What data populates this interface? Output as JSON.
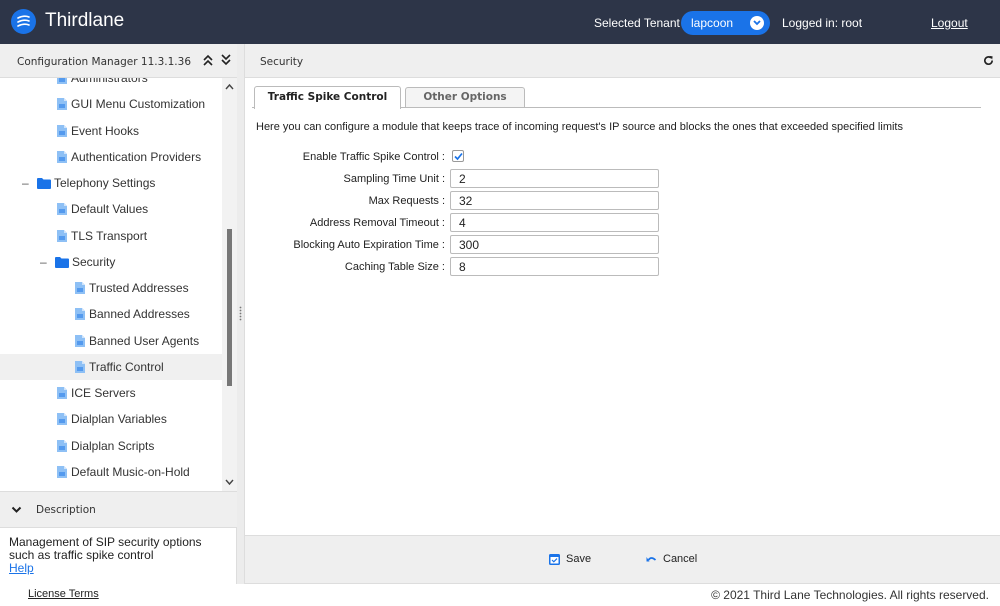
{
  "header": {
    "brand": "Thirdlane",
    "tenant_label": "Selected Tenant :",
    "tenant_value": "lapcoon",
    "logged_in": "Logged in: root",
    "logout": "Logout"
  },
  "left_panel": {
    "title": "Configuration Manager 11.3.1.36",
    "tree": [
      {
        "label": "Administrators",
        "type": "doc",
        "level": 2
      },
      {
        "label": "GUI Menu Customization",
        "type": "doc",
        "level": 2
      },
      {
        "label": "Event Hooks",
        "type": "doc",
        "level": 2
      },
      {
        "label": "Authentication Providers",
        "type": "doc",
        "level": 2
      },
      {
        "label": "Telephony Settings",
        "type": "folder",
        "level": 1,
        "expanded": true
      },
      {
        "label": "Default Values",
        "type": "doc",
        "level": 2
      },
      {
        "label": "TLS Transport",
        "type": "doc",
        "level": 2
      },
      {
        "label": "Security",
        "type": "folder",
        "level": 2,
        "expanded": true
      },
      {
        "label": "Trusted Addresses",
        "type": "doc",
        "level": 3
      },
      {
        "label": "Banned Addresses",
        "type": "doc",
        "level": 3
      },
      {
        "label": "Banned User Agents",
        "type": "doc",
        "level": 3
      },
      {
        "label": "Traffic Control",
        "type": "doc",
        "level": 3,
        "selected": true
      },
      {
        "label": "ICE Servers",
        "type": "doc",
        "level": 2
      },
      {
        "label": "Dialplan Variables",
        "type": "doc",
        "level": 2
      },
      {
        "label": "Dialplan Scripts",
        "type": "doc",
        "level": 2
      },
      {
        "label": "Default Music-on-Hold",
        "type": "doc",
        "level": 2
      }
    ],
    "description_title": "Description",
    "description_text": "Management of SIP security options such as traffic spike control",
    "help_link": "Help"
  },
  "main": {
    "title": "Security",
    "tabs": [
      {
        "label": "Traffic Spike Control",
        "active": true
      },
      {
        "label": "Other Options",
        "active": false
      }
    ],
    "intro": "Here you can configure a module that keeps trace of incoming request's IP source and blocks the ones that exceeded specified limits",
    "enable_label": "Enable Traffic Spike Control :",
    "enable_checked": true,
    "fields": [
      {
        "label": "Sampling Time Unit :",
        "value": "2"
      },
      {
        "label": "Max Requests :",
        "value": "32"
      },
      {
        "label": "Address Removal Timeout :",
        "value": "4"
      },
      {
        "label": "Blocking Auto Expiration Time :",
        "value": "300"
      },
      {
        "label": "Caching Table Size :",
        "value": "8"
      }
    ],
    "save_label": "Save",
    "cancel_label": "Cancel"
  },
  "footer": {
    "license": "License Terms",
    "copyright": "© 2021 Third Lane Technologies. All rights reserved."
  },
  "colors": {
    "topbar": "#2d3548",
    "accent": "#1a73e8"
  }
}
